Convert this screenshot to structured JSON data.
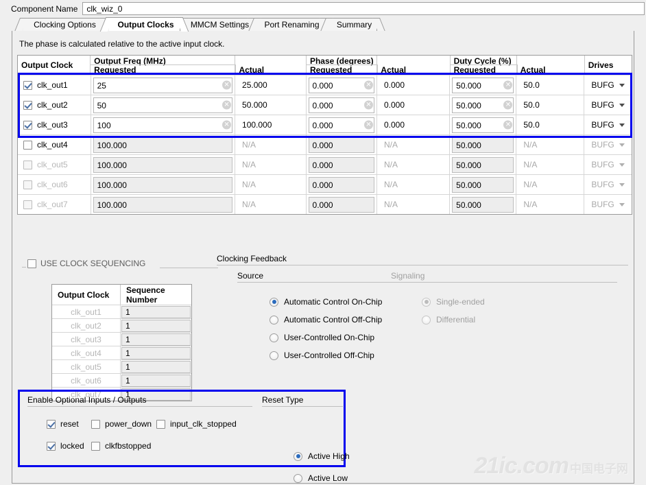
{
  "component": {
    "label": "Component Name",
    "value": "clk_wiz_0"
  },
  "tabs": [
    {
      "label": "Clocking Options",
      "active": false
    },
    {
      "label": "Output Clocks",
      "active": true
    },
    {
      "label": "MMCM Settings",
      "active": false
    },
    {
      "label": "Port Renaming",
      "active": false
    },
    {
      "label": "Summary",
      "active": false
    }
  ],
  "hint": "The phase is calculated relative to the active input clock.",
  "clock_table": {
    "headers": {
      "output_clock": "Output Clock",
      "output_freq": "Output Freq (MHz)",
      "phase": "Phase (degrees)",
      "duty": "Duty Cycle (%)",
      "drives": "Drives",
      "requested": "Requested",
      "actual": "Actual"
    },
    "rows": [
      {
        "name": "clk_out1",
        "enabled": true,
        "freq_req": "25",
        "freq_act": "25.000",
        "phase_req": "0.000",
        "phase_act": "0.000",
        "duty_req": "50.000",
        "duty_act": "50.0",
        "drives": "BUFG"
      },
      {
        "name": "clk_out2",
        "enabled": true,
        "freq_req": "50",
        "freq_act": "50.000",
        "phase_req": "0.000",
        "phase_act": "0.000",
        "duty_req": "50.000",
        "duty_act": "50.0",
        "drives": "BUFG"
      },
      {
        "name": "clk_out3",
        "enabled": true,
        "freq_req": "100",
        "freq_act": "100.000",
        "phase_req": "0.000",
        "phase_act": "0.000",
        "duty_req": "50.000",
        "duty_act": "50.0",
        "drives": "BUFG"
      },
      {
        "name": "clk_out4",
        "enabled": false,
        "freq_req": "100.000",
        "freq_act": "N/A",
        "phase_req": "0.000",
        "phase_act": "N/A",
        "duty_req": "50.000",
        "duty_act": "N/A",
        "drives": "BUFG"
      },
      {
        "name": "clk_out5",
        "enabled": false,
        "freq_req": "100.000",
        "freq_act": "N/A",
        "phase_req": "0.000",
        "phase_act": "N/A",
        "duty_req": "50.000",
        "duty_act": "N/A",
        "drives": "BUFG"
      },
      {
        "name": "clk_out6",
        "enabled": false,
        "freq_req": "100.000",
        "freq_act": "N/A",
        "phase_req": "0.000",
        "phase_act": "N/A",
        "duty_req": "50.000",
        "duty_act": "N/A",
        "drives": "BUFG"
      },
      {
        "name": "clk_out7",
        "enabled": false,
        "freq_req": "100.000",
        "freq_act": "N/A",
        "phase_req": "0.000",
        "phase_act": "N/A",
        "duty_req": "50.000",
        "duty_act": "N/A",
        "drives": "BUFG"
      }
    ]
  },
  "sequencing": {
    "checkbox_label": "USE CLOCK SEQUENCING",
    "checked": false,
    "headers": {
      "clock": "Output Clock",
      "sequence": "Sequence Number"
    },
    "rows": [
      {
        "name": "clk_out1",
        "value": "1"
      },
      {
        "name": "clk_out2",
        "value": "1"
      },
      {
        "name": "clk_out3",
        "value": "1"
      },
      {
        "name": "clk_out4",
        "value": "1"
      },
      {
        "name": "clk_out5",
        "value": "1"
      },
      {
        "name": "clk_out6",
        "value": "1"
      },
      {
        "name": "clk_out7",
        "value": "1"
      }
    ]
  },
  "clocking_feedback": {
    "title": "Clocking Feedback",
    "source": {
      "label": "Source",
      "options": [
        {
          "label": "Automatic Control On-Chip",
          "selected": true
        },
        {
          "label": "Automatic Control Off-Chip",
          "selected": false
        },
        {
          "label": "User-Controlled On-Chip",
          "selected": false
        },
        {
          "label": "User-Controlled Off-Chip",
          "selected": false
        }
      ]
    },
    "signaling": {
      "label": "Signaling",
      "disabled": true,
      "options": [
        {
          "label": "Single-ended",
          "selected": true
        },
        {
          "label": "Differential",
          "selected": false
        }
      ]
    }
  },
  "optional_io": {
    "title": "Enable Optional Inputs / Outputs",
    "checkboxes": [
      {
        "label": "reset",
        "checked": true
      },
      {
        "label": "power_down",
        "checked": false
      },
      {
        "label": "input_clk_stopped",
        "checked": false
      },
      {
        "label": "locked",
        "checked": true
      },
      {
        "label": "clkfbstopped",
        "checked": false
      }
    ]
  },
  "reset_type": {
    "title": "Reset Type",
    "options": [
      {
        "label": "Active High",
        "selected": true
      },
      {
        "label": "Active Low",
        "selected": false
      }
    ]
  },
  "watermark": {
    "main": "21ic.com",
    "cn": "中国电子网"
  },
  "colors": {
    "highlight": "#0000ee",
    "accent": "#2a6bbd"
  }
}
